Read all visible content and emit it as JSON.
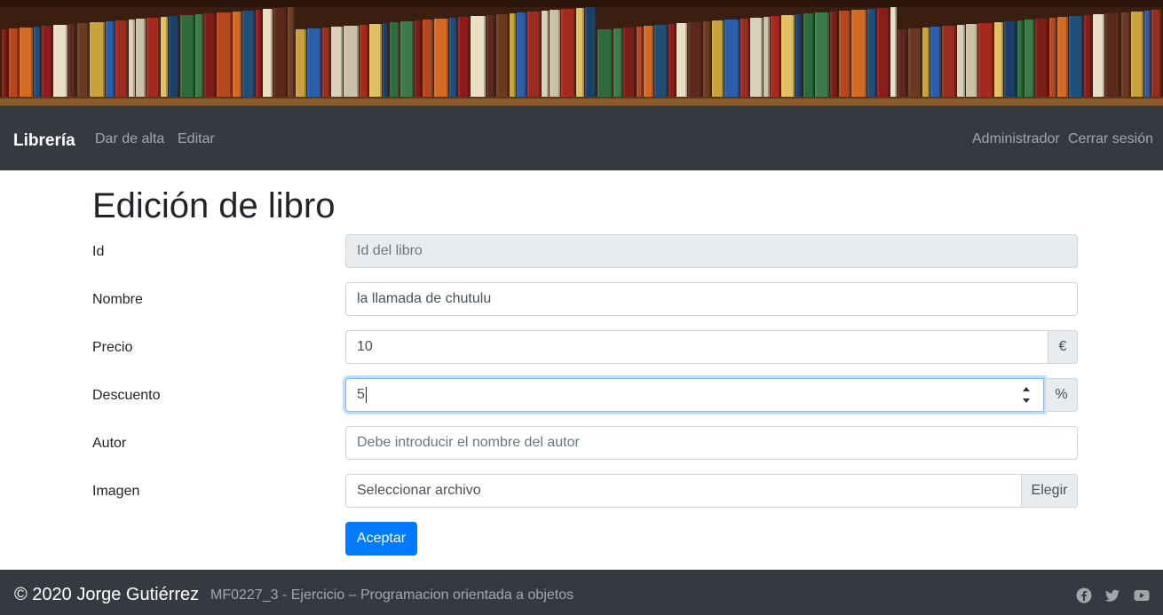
{
  "navbar": {
    "brand": "Librería",
    "links": [
      "Dar de alta",
      "Editar"
    ],
    "user": "Administrador",
    "logout": "Cerrar sesión"
  },
  "page": {
    "title": "Edición de libro"
  },
  "form": {
    "id": {
      "label": "Id",
      "placeholder": "Id del libro",
      "value": ""
    },
    "nombre": {
      "label": "Nombre",
      "value": "la llamada de chutulu"
    },
    "precio": {
      "label": "Precio",
      "value": "10",
      "addon": "€"
    },
    "descuento": {
      "label": "Descuento",
      "value": "5",
      "addon": "%"
    },
    "autor": {
      "label": "Autor",
      "placeholder": "Debe introducir el nombre del autor",
      "value": ""
    },
    "imagen": {
      "label": "Imagen",
      "file_text": "Seleccionar archivo",
      "browse": "Elegir"
    },
    "submit": "Aceptar"
  },
  "footer": {
    "copyright": "© 2020 Jorge Gutiérrez",
    "subtitle": "MF0227_3 - Ejercicio – Programacion orientada a objetos",
    "social": [
      "facebook-icon",
      "twitter-icon",
      "youtube-icon"
    ]
  },
  "colors": {
    "navbar": "#343a40",
    "primary": "#007bff",
    "input_border": "#ced4da",
    "readonly_bg": "#e9ecef",
    "focus_border": "#80bdff"
  }
}
